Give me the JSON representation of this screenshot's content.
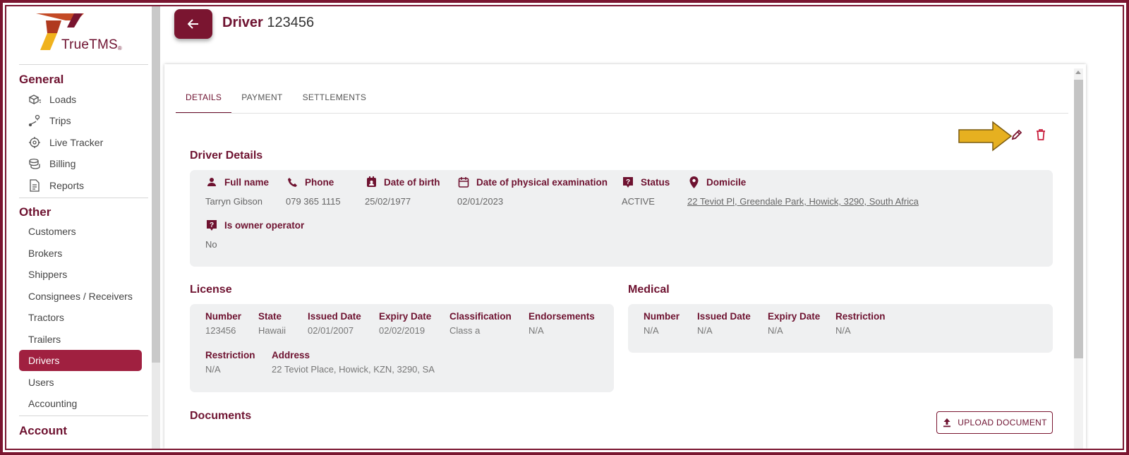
{
  "app": {
    "logo_text": "TrueTMS",
    "logo_mark": "®"
  },
  "sidebar": {
    "general_title": "General",
    "general_items": [
      {
        "label": "Loads",
        "icon": "boxes-icon"
      },
      {
        "label": "Trips",
        "icon": "route-icon"
      },
      {
        "label": "Live Tracker",
        "icon": "crosshair-icon"
      },
      {
        "label": "Billing",
        "icon": "coins-icon"
      },
      {
        "label": "Reports",
        "icon": "report-icon"
      }
    ],
    "other_title": "Other",
    "other_items": [
      {
        "label": "Customers"
      },
      {
        "label": "Brokers"
      },
      {
        "label": "Shippers"
      },
      {
        "label": "Consignees / Receivers"
      },
      {
        "label": "Tractors"
      },
      {
        "label": "Trailers"
      },
      {
        "label": "Drivers",
        "active": true
      },
      {
        "label": "Users"
      },
      {
        "label": "Accounting"
      }
    ],
    "account_title": "Account"
  },
  "header": {
    "title_bold": "Driver",
    "title_id": "123456"
  },
  "tabs": [
    {
      "label": "DETAILS",
      "active": true
    },
    {
      "label": "PAYMENT"
    },
    {
      "label": "SETTLEMENTS"
    }
  ],
  "driver_details": {
    "title": "Driver Details",
    "full_name_label": "Full name",
    "full_name": "Tarryn Gibson",
    "phone_label": "Phone",
    "phone": "079 365 1115",
    "dob_label": "Date of birth",
    "dob": "25/02/1977",
    "exam_label": "Date of physical examination",
    "exam": "02/01/2023",
    "status_label": "Status",
    "status": "ACTIVE",
    "domicile_label": "Domicile",
    "domicile": "22 Teviot Pl, Greendale Park, Howick, 3290, South Africa",
    "owner_label": "Is owner operator",
    "owner": "No"
  },
  "license": {
    "title": "License",
    "number_label": "Number",
    "number": "123456",
    "state_label": "State",
    "state": "Hawaii",
    "issued_label": "Issued Date",
    "issued": "02/01/2007",
    "expiry_label": "Expiry Date",
    "expiry": "02/02/2019",
    "class_label": "Classification",
    "class": "Class a",
    "endorse_label": "Endorsements",
    "endorse": "N/A",
    "restriction_label": "Restriction",
    "restriction": "N/A",
    "address_label": "Address",
    "address": "22 Teviot Place, Howick, KZN, 3290, SA"
  },
  "medical": {
    "title": "Medical",
    "number_label": "Number",
    "number": "N/A",
    "issued_label": "Issued Date",
    "issued": "N/A",
    "expiry_label": "Expiry Date",
    "expiry": "N/A",
    "restriction_label": "Restriction",
    "restriction": "N/A"
  },
  "documents": {
    "title": "Documents",
    "upload_label": "UPLOAD DOCUMENT"
  },
  "colors": {
    "brand": "#6e1230",
    "active_nav": "#a02040",
    "arrow": "#e6b020",
    "delete": "#c9203e"
  }
}
